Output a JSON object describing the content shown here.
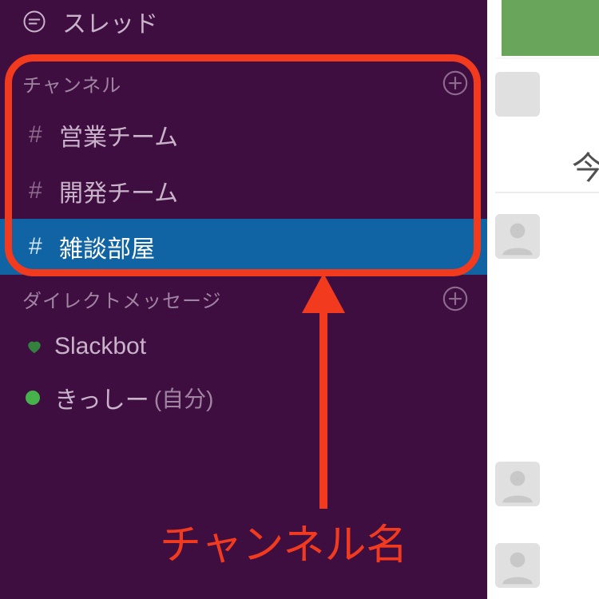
{
  "sidebar": {
    "threads_label": "スレッド",
    "channels_header": "チャンネル",
    "channels": [
      {
        "name": "営業チーム",
        "selected": false
      },
      {
        "name": "開発チーム",
        "selected": false
      },
      {
        "name": "雑談部屋",
        "selected": true
      }
    ],
    "dm_header": "ダイレクトメッセージ",
    "dms": [
      {
        "name": "Slackbot",
        "presence": "heart",
        "self_suffix": ""
      },
      {
        "name": "きっしー",
        "presence": "online",
        "self_suffix": "(自分)"
      }
    ]
  },
  "main_fragment": {
    "visible_text": "今"
  },
  "annotation": {
    "label": "チャンネル名",
    "colors": {
      "accent": "#f23a1e",
      "sidebar_bg": "#3F0E40",
      "selected_bg": "#1164A3"
    }
  }
}
